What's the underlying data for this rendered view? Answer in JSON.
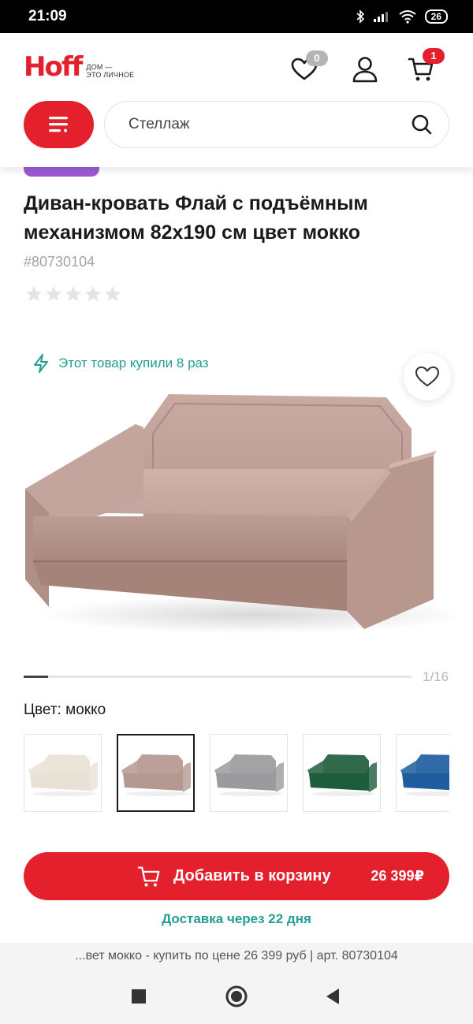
{
  "status_bar": {
    "time": "21:09",
    "battery": "26"
  },
  "header": {
    "logo_text": "Hoff",
    "logo_tagline_1": "ДОМ —",
    "logo_tagline_2": "ЭТО ЛИЧНОЕ",
    "favorites_count": "0",
    "cart_count": "1",
    "accent_color": "#e3202c"
  },
  "search": {
    "value": "Стеллаж"
  },
  "product": {
    "title": "Диван-кровать Флай с подъёмным механизмом 82х190 см цвет мокко",
    "sku": "#80730104",
    "rating_stars": 0,
    "bought_text": "Этот товар купили 8 раз",
    "gallery_counter": "1/16",
    "gallery_progress": 0.0625,
    "color_label": "Цвет:",
    "color_value": "мокко",
    "swatches": [
      {
        "name": "cream",
        "color": "#e8e2d6"
      },
      {
        "name": "mocha",
        "color": "#b59890",
        "selected": true
      },
      {
        "name": "gray",
        "color": "#9b9b9e"
      },
      {
        "name": "green",
        "color": "#1e5d3c"
      },
      {
        "name": "blue",
        "color": "#1f5d9e"
      }
    ]
  },
  "cart": {
    "button_label": "Добавить в корзину",
    "price": "26 399₽"
  },
  "delivery_text": "Доставка через 22 дня",
  "url_bar_text": "...вет мокко - купить по цене 26 399 руб | арт. 80730104"
}
